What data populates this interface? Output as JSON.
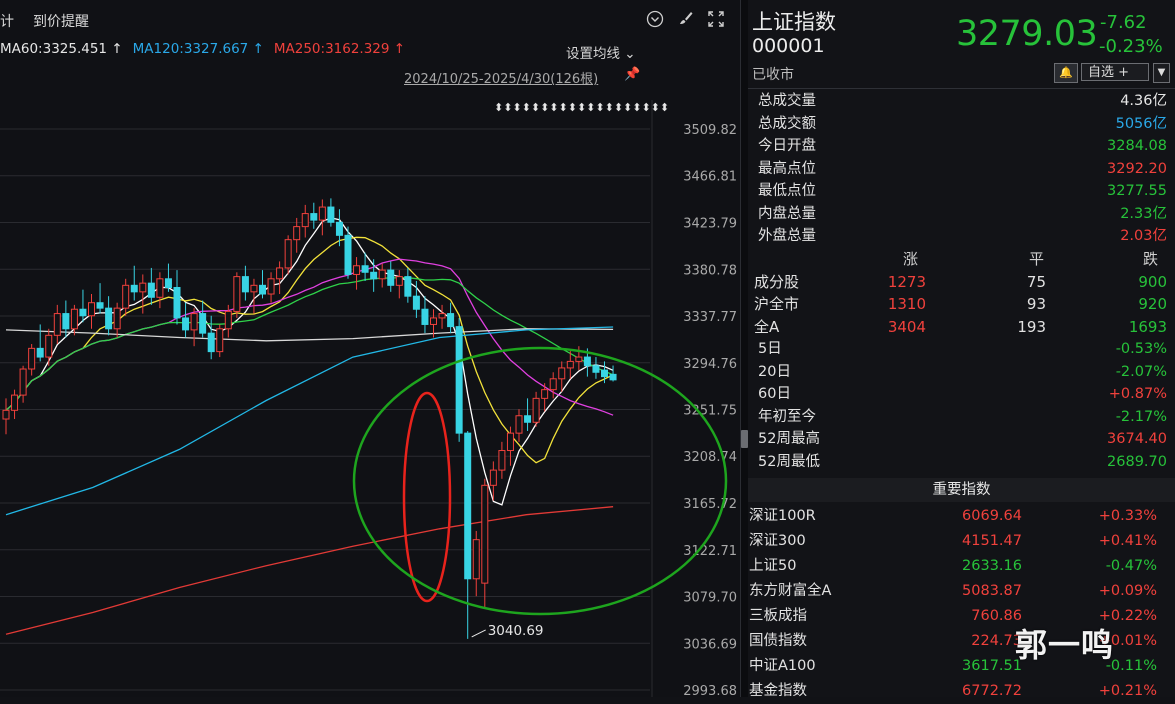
{
  "toolbar": {
    "tab_partial": "计",
    "price_alert": "到价提醒",
    "icons": [
      "chevron-circle-icon",
      "brush-icon",
      "expand-icon"
    ]
  },
  "ma_legend": {
    "ma60": "MA60:3325.451",
    "ma120": "MA120:3327.667",
    "ma250": "MA250:3162.329",
    "ma120_arrow": "↑",
    "ma250_arrow": "↑",
    "ma60_arrow": "↑",
    "settings": "设置均线",
    "range": "2024/10/25-2025/4/30(126根)",
    "colors": {
      "ma60": "#e6e6e6",
      "ma120": "#22b8e6",
      "ma250": "#e23a36"
    }
  },
  "chart_data": {
    "type": "candlestick",
    "y_ticks": [
      "3509.82",
      "3466.81",
      "3423.79",
      "3380.78",
      "3337.77",
      "3294.76",
      "3251.75",
      "3208.74",
      "3165.72",
      "3122.71",
      "3079.70",
      "3036.69",
      "2993.68"
    ],
    "ylim": [
      2993.68,
      3509.82
    ],
    "low_marker": "3040.69",
    "candles": [
      {
        "o": 3243,
        "h": 3262,
        "l": 3229,
        "c": 3251
      },
      {
        "o": 3251,
        "h": 3270,
        "l": 3243,
        "c": 3265
      },
      {
        "o": 3265,
        "h": 3292,
        "l": 3258,
        "c": 3289
      },
      {
        "o": 3289,
        "h": 3312,
        "l": 3283,
        "c": 3308
      },
      {
        "o": 3308,
        "h": 3330,
        "l": 3296,
        "c": 3300
      },
      {
        "o": 3300,
        "h": 3326,
        "l": 3292,
        "c": 3320
      },
      {
        "o": 3320,
        "h": 3348,
        "l": 3312,
        "c": 3340
      },
      {
        "o": 3340,
        "h": 3352,
        "l": 3318,
        "c": 3326
      },
      {
        "o": 3326,
        "h": 3348,
        "l": 3320,
        "c": 3344
      },
      {
        "o": 3344,
        "h": 3362,
        "l": 3332,
        "c": 3338
      },
      {
        "o": 3338,
        "h": 3358,
        "l": 3326,
        "c": 3350
      },
      {
        "o": 3350,
        "h": 3368,
        "l": 3340,
        "c": 3345
      },
      {
        "o": 3345,
        "h": 3356,
        "l": 3320,
        "c": 3326
      },
      {
        "o": 3326,
        "h": 3350,
        "l": 3318,
        "c": 3345
      },
      {
        "o": 3345,
        "h": 3372,
        "l": 3338,
        "c": 3366
      },
      {
        "o": 3366,
        "h": 3384,
        "l": 3352,
        "c": 3360
      },
      {
        "o": 3360,
        "h": 3376,
        "l": 3340,
        "c": 3368
      },
      {
        "o": 3368,
        "h": 3382,
        "l": 3348,
        "c": 3355
      },
      {
        "o": 3355,
        "h": 3378,
        "l": 3345,
        "c": 3372
      },
      {
        "o": 3372,
        "h": 3386,
        "l": 3360,
        "c": 3364
      },
      {
        "o": 3364,
        "h": 3380,
        "l": 3330,
        "c": 3336
      },
      {
        "o": 3336,
        "h": 3350,
        "l": 3318,
        "c": 3325
      },
      {
        "o": 3325,
        "h": 3345,
        "l": 3310,
        "c": 3340
      },
      {
        "o": 3340,
        "h": 3352,
        "l": 3318,
        "c": 3322
      },
      {
        "o": 3322,
        "h": 3338,
        "l": 3298,
        "c": 3305
      },
      {
        "o": 3305,
        "h": 3330,
        "l": 3300,
        "c": 3326
      },
      {
        "o": 3326,
        "h": 3348,
        "l": 3318,
        "c": 3342
      },
      {
        "o": 3342,
        "h": 3378,
        "l": 3336,
        "c": 3374
      },
      {
        "o": 3374,
        "h": 3384,
        "l": 3352,
        "c": 3360
      },
      {
        "o": 3360,
        "h": 3372,
        "l": 3340,
        "c": 3366
      },
      {
        "o": 3366,
        "h": 3380,
        "l": 3354,
        "c": 3358
      },
      {
        "o": 3358,
        "h": 3378,
        "l": 3350,
        "c": 3372
      },
      {
        "o": 3372,
        "h": 3388,
        "l": 3358,
        "c": 3382
      },
      {
        "o": 3382,
        "h": 3412,
        "l": 3376,
        "c": 3408
      },
      {
        "o": 3408,
        "h": 3428,
        "l": 3396,
        "c": 3420
      },
      {
        "o": 3420,
        "h": 3440,
        "l": 3410,
        "c": 3432
      },
      {
        "o": 3432,
        "h": 3442,
        "l": 3418,
        "c": 3426
      },
      {
        "o": 3426,
        "h": 3445,
        "l": 3412,
        "c": 3438
      },
      {
        "o": 3438,
        "h": 3446,
        "l": 3420,
        "c": 3424
      },
      {
        "o": 3424,
        "h": 3436,
        "l": 3402,
        "c": 3412
      },
      {
        "o": 3412,
        "h": 3420,
        "l": 3372,
        "c": 3376
      },
      {
        "o": 3376,
        "h": 3392,
        "l": 3362,
        "c": 3384
      },
      {
        "o": 3384,
        "h": 3396,
        "l": 3370,
        "c": 3378
      },
      {
        "o": 3378,
        "h": 3390,
        "l": 3360,
        "c": 3372
      },
      {
        "o": 3372,
        "h": 3386,
        "l": 3364,
        "c": 3380
      },
      {
        "o": 3380,
        "h": 3388,
        "l": 3360,
        "c": 3366
      },
      {
        "o": 3366,
        "h": 3380,
        "l": 3354,
        "c": 3374
      },
      {
        "o": 3374,
        "h": 3382,
        "l": 3350,
        "c": 3356
      },
      {
        "o": 3356,
        "h": 3370,
        "l": 3336,
        "c": 3344
      },
      {
        "o": 3344,
        "h": 3356,
        "l": 3322,
        "c": 3330
      },
      {
        "o": 3330,
        "h": 3344,
        "l": 3318,
        "c": 3336
      },
      {
        "o": 3336,
        "h": 3348,
        "l": 3326,
        "c": 3340
      },
      {
        "o": 3340,
        "h": 3350,
        "l": 3322,
        "c": 3328
      },
      {
        "o": 3328,
        "h": 3336,
        "l": 3222,
        "c": 3230
      },
      {
        "o": 3230,
        "h": 3232,
        "l": 3040.69,
        "c": 3096
      },
      {
        "o": 3096,
        "h": 3140,
        "l": 3080,
        "c": 3132
      },
      {
        "o": 3092,
        "h": 3188,
        "l": 3070,
        "c": 3182
      },
      {
        "o": 3182,
        "h": 3204,
        "l": 3168,
        "c": 3196
      },
      {
        "o": 3196,
        "h": 3222,
        "l": 3188,
        "c": 3214
      },
      {
        "o": 3214,
        "h": 3236,
        "l": 3200,
        "c": 3230
      },
      {
        "o": 3230,
        "h": 3252,
        "l": 3222,
        "c": 3246
      },
      {
        "o": 3246,
        "h": 3262,
        "l": 3232,
        "c": 3240
      },
      {
        "o": 3240,
        "h": 3268,
        "l": 3236,
        "c": 3262
      },
      {
        "o": 3262,
        "h": 3276,
        "l": 3250,
        "c": 3270
      },
      {
        "o": 3270,
        "h": 3286,
        "l": 3262,
        "c": 3280
      },
      {
        "o": 3280,
        "h": 3296,
        "l": 3268,
        "c": 3290
      },
      {
        "o": 3290,
        "h": 3306,
        "l": 3280,
        "c": 3296
      },
      {
        "o": 3296,
        "h": 3310,
        "l": 3288,
        "c": 3300
      },
      {
        "o": 3300,
        "h": 3308,
        "l": 3282,
        "c": 3292
      },
      {
        "o": 3292,
        "h": 3300,
        "l": 3280,
        "c": 3286
      },
      {
        "o": 3288,
        "h": 3296,
        "l": 3276,
        "c": 3282
      },
      {
        "o": 3284.08,
        "h": 3292.2,
        "l": 3277.55,
        "c": 3279.03
      }
    ]
  },
  "annotations": {
    "red_ellipse": "crash-candles-highlight",
    "green_ellipse": "rebound-highlight"
  },
  "quote": {
    "name": "上证指数",
    "code": "000001",
    "status": "已收市",
    "price": "3279.03",
    "change": "-7.62",
    "change_pct": "-0.23%",
    "watch_label": "自选 +",
    "stats": [
      {
        "label": "总成交量",
        "value": "4.36亿",
        "color": "white"
      },
      {
        "label": "总成交额",
        "value": "5056亿",
        "color": "cyan"
      },
      {
        "label": "今日开盘",
        "value": "3284.08",
        "color": "green"
      },
      {
        "label": "最高点位",
        "value": "3292.20",
        "color": "red"
      },
      {
        "label": "最低点位",
        "value": "3277.55",
        "color": "green"
      },
      {
        "label": "内盘总量",
        "value": "2.33亿",
        "color": "green"
      },
      {
        "label": "外盘总量",
        "value": "2.03亿",
        "color": "red"
      }
    ],
    "breadth_header": [
      "涨",
      "平",
      "跌"
    ],
    "breadth": [
      {
        "label": "成分股",
        "up": "1273",
        "flat": "75",
        "down": "900"
      },
      {
        "label": "沪全市",
        "up": "1310",
        "flat": "93",
        "down": "920"
      },
      {
        "label": "全A",
        "up": "3404",
        "flat": "193",
        "down": "1693"
      }
    ],
    "periods": [
      {
        "label": "5日",
        "value": "-0.53%",
        "color": "green"
      },
      {
        "label": "20日",
        "value": "-2.07%",
        "color": "green"
      },
      {
        "label": "60日",
        "value": "+0.87%",
        "color": "red"
      },
      {
        "label": "年初至今",
        "value": "-2.17%",
        "color": "green"
      },
      {
        "label": "52周最高",
        "value": "3674.40",
        "color": "red"
      },
      {
        "label": "52周最低",
        "value": "2689.70",
        "color": "green"
      }
    ],
    "index_header": "重要指数",
    "indices": [
      {
        "name": "深证100R",
        "value": "6069.64",
        "pct": "+0.33%",
        "color": "red"
      },
      {
        "name": "深证300",
        "value": "4151.47",
        "pct": "+0.41%",
        "color": "red"
      },
      {
        "name": "上证50",
        "value": "2633.16",
        "pct": "-0.47%",
        "color": "green"
      },
      {
        "name": "东方财富全A",
        "value": "5083.87",
        "pct": "+0.09%",
        "color": "red"
      },
      {
        "name": "三板成指",
        "value": "760.86",
        "pct": "+0.22%",
        "color": "red"
      },
      {
        "name": "国债指数",
        "value": "224.73",
        "pct": "+0.01%",
        "color": "red"
      },
      {
        "name": "中证A100",
        "value": "3617.51",
        "pct": "-0.11%",
        "color": "green"
      },
      {
        "name": "基金指数",
        "value": "6772.72",
        "pct": "+0.21%",
        "color": "red"
      }
    ],
    "watermark": "郭一鸣"
  }
}
